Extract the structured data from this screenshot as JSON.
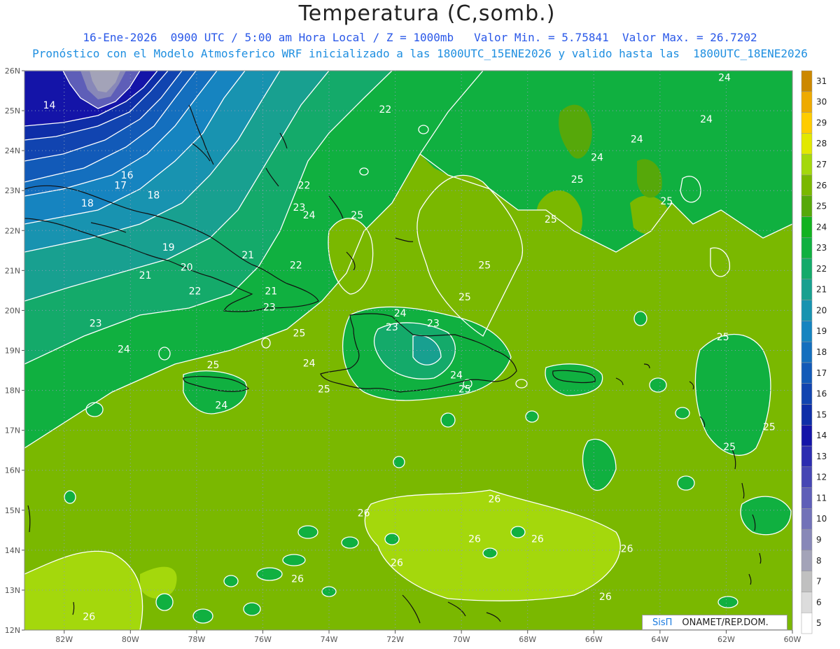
{
  "header": {
    "title": "Temperatura (C,somb.)",
    "line1": "16-Ene-2026  0900 UTC / 5:00 am Hora Local / Z = 1000mb   Valor Min. = 5.75841  Valor Max. = 26.7202",
    "line2": "Pronóstico con el Modelo Atmosferico WRF inicializado a las 1800UTC_15ENE2026 y valido hasta las  1800UTC_18ENE2026"
  },
  "map": {
    "lon_range": [
      -83.2,
      -60
    ],
    "lat_range": [
      12,
      26
    ],
    "lat_labels": [
      "26N",
      "25N",
      "24N",
      "23N",
      "22N",
      "21N",
      "20N",
      "19N",
      "18N",
      "17N",
      "16N",
      "15N",
      "14N",
      "13N",
      "12N"
    ],
    "lon_labels": [
      "82W",
      "80W",
      "78W",
      "76W",
      "74W",
      "72W",
      "70W",
      "68W",
      "66W",
      "64W",
      "62W",
      "60W"
    ],
    "contour_labels": [
      {
        "t": "14",
        "lon": -82.45,
        "lat": 25.05
      },
      {
        "t": "16",
        "lon": -80.1,
        "lat": 23.3
      },
      {
        "t": "17",
        "lon": -80.3,
        "lat": 23.05
      },
      {
        "t": "18",
        "lon": -79.3,
        "lat": 22.8
      },
      {
        "t": "18",
        "lon": -81.3,
        "lat": 22.6
      },
      {
        "t": "19",
        "lon": -78.85,
        "lat": 21.5
      },
      {
        "t": "20",
        "lon": -78.3,
        "lat": 21.0
      },
      {
        "t": "21",
        "lon": -79.55,
        "lat": 20.8
      },
      {
        "t": "21",
        "lon": -76.45,
        "lat": 21.3
      },
      {
        "t": "21",
        "lon": -75.75,
        "lat": 20.4
      },
      {
        "t": "22",
        "lon": -78.05,
        "lat": 20.4
      },
      {
        "t": "22",
        "lon": -75.0,
        "lat": 21.05
      },
      {
        "t": "22",
        "lon": -74.75,
        "lat": 23.05
      },
      {
        "t": "22",
        "lon": -72.3,
        "lat": 24.95
      },
      {
        "t": "23",
        "lon": -74.9,
        "lat": 22.5
      },
      {
        "t": "23",
        "lon": -75.8,
        "lat": 20.0
      },
      {
        "t": "23",
        "lon": -81.05,
        "lat": 19.6
      },
      {
        "t": "24",
        "lon": -74.6,
        "lat": 22.3
      },
      {
        "t": "24",
        "lon": -80.2,
        "lat": 18.95
      },
      {
        "t": "24",
        "lon": -77.25,
        "lat": 17.55
      },
      {
        "t": "24",
        "lon": -74.6,
        "lat": 18.6
      },
      {
        "t": "24",
        "lon": -71.85,
        "lat": 19.85
      },
      {
        "t": "24",
        "lon": -70.15,
        "lat": 18.3
      },
      {
        "t": "24",
        "lon": -65.9,
        "lat": 23.75
      },
      {
        "t": "24",
        "lon": -64.7,
        "lat": 24.2
      },
      {
        "t": "24",
        "lon": -62.6,
        "lat": 24.7
      },
      {
        "t": "24",
        "lon": -62.05,
        "lat": 25.75
      },
      {
        "t": "25",
        "lon": -77.5,
        "lat": 18.55
      },
      {
        "t": "25",
        "lon": -73.15,
        "lat": 22.3
      },
      {
        "t": "25",
        "lon": -74.9,
        "lat": 19.35
      },
      {
        "t": "25",
        "lon": -74.15,
        "lat": 17.95
      },
      {
        "t": "25",
        "lon": -69.9,
        "lat": 20.25
      },
      {
        "t": "25",
        "lon": -69.3,
        "lat": 21.05
      },
      {
        "t": "25",
        "lon": -69.9,
        "lat": 17.95
      },
      {
        "t": "25",
        "lon": -67.3,
        "lat": 22.2
      },
      {
        "t": "25",
        "lon": -66.5,
        "lat": 23.2
      },
      {
        "t": "25",
        "lon": -63.8,
        "lat": 22.65
      },
      {
        "t": "25",
        "lon": -62.1,
        "lat": 19.25
      },
      {
        "t": "25",
        "lon": -60.7,
        "lat": 17.0
      },
      {
        "t": "25",
        "lon": -61.9,
        "lat": 16.5
      },
      {
        "t": "23",
        "lon": -72.1,
        "lat": 19.5
      },
      {
        "t": "23",
        "lon": -70.85,
        "lat": 19.6
      },
      {
        "t": "26",
        "lon": -72.95,
        "lat": 14.85
      },
      {
        "t": "26",
        "lon": -71.95,
        "lat": 13.6
      },
      {
        "t": "26",
        "lon": -69.6,
        "lat": 14.2
      },
      {
        "t": "26",
        "lon": -69.0,
        "lat": 15.2
      },
      {
        "t": "26",
        "lon": -67.7,
        "lat": 14.2
      },
      {
        "t": "26",
        "lon": -65.0,
        "lat": 13.95
      },
      {
        "t": "26",
        "lon": -65.65,
        "lat": 12.75
      },
      {
        "t": "26",
        "lon": -74.95,
        "lat": 13.2
      },
      {
        "t": "26",
        "lon": -81.25,
        "lat": 12.25
      }
    ]
  },
  "colorbar": {
    "levels": [
      "5",
      "6",
      "7",
      "8",
      "9",
      "10",
      "11",
      "12",
      "13",
      "14",
      "15",
      "16",
      "17",
      "18",
      "19",
      "20",
      "21",
      "22",
      "23",
      "24",
      "25",
      "26",
      "27",
      "28",
      "29",
      "30",
      "31"
    ],
    "colors": [
      "#ffffff",
      "#dcdcdc",
      "#c0c0c0",
      "#a3a3b8",
      "#8888b8",
      "#7272b8",
      "#5e5eb8",
      "#4646b4",
      "#2c2cb0",
      "#1414a8",
      "#0e2ea8",
      "#1144b0",
      "#125ab8",
      "#146fbe",
      "#1684c0",
      "#1893b0",
      "#18a090",
      "#14aa6a",
      "#10b040",
      "#12b220",
      "#56a80a",
      "#7ab800",
      "#a4d80c",
      "#e2e800",
      "#ffcc00",
      "#eeaa00",
      "#cc8800"
    ]
  },
  "credit": {
    "logo": "SisΠ",
    "org": "ONAMET/REP.DOM."
  }
}
